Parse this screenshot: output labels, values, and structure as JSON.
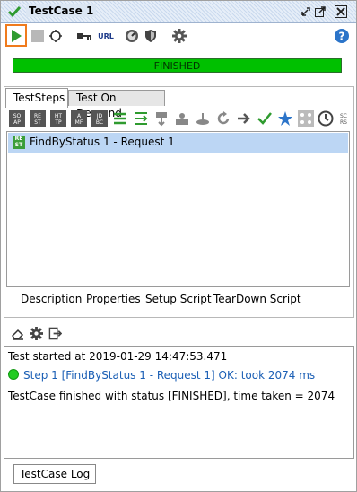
{
  "window": {
    "title": "TestCase 1"
  },
  "toolbar": {
    "icons": [
      "run-icon",
      "stop-icon",
      "loop-icon",
      "key-icon",
      "url-icon",
      "gauge-icon",
      "shield-icon",
      "gear-icon",
      "help-icon"
    ],
    "url_label": "URL"
  },
  "status": {
    "text": "FINISHED",
    "color": "#00c000"
  },
  "tabs": [
    {
      "label": "TestSteps",
      "active": true
    },
    {
      "label": "Test On Demand",
      "active": false
    }
  ],
  "step_toolbar": {
    "labels": {
      "soap": "SO AP",
      "rest": "RE ST",
      "http": "HT TP",
      "amf": "A MF",
      "jdbc": "JD BC",
      "scroll": "SC RS"
    }
  },
  "steps": [
    {
      "icon_text": "RE ST",
      "label": "FindByStatus 1 - Request 1",
      "selected": true
    }
  ],
  "bottom_tabs": [
    "Description",
    "Properties",
    "Setup Script",
    "TearDown Script"
  ],
  "log": {
    "lines": [
      "Test started at 2019-01-29 14:47:53.471",
      "Step 1 [FindByStatus 1 - Request 1] OK: took 2074 ms",
      "TestCase finished with status [FINISHED], time taken = 2074"
    ],
    "tab_label": "TestCase Log"
  },
  "colors": {
    "accent": "#f07b1d",
    "selection": "#bcd6f4",
    "ok": "#22cc22",
    "link": "#1b5fb5"
  }
}
